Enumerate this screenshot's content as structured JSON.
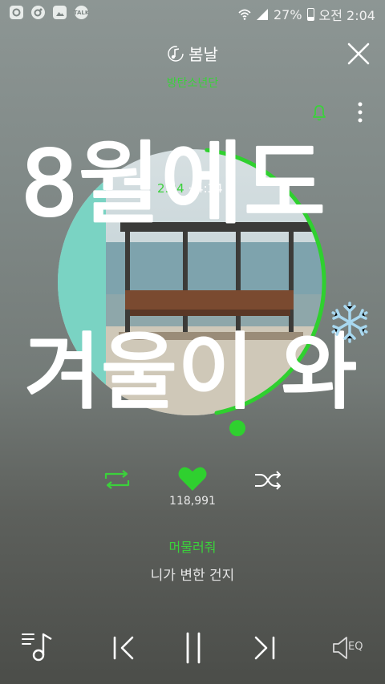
{
  "status_bar": {
    "left_icons": [
      "notification-app-icon",
      "kakaostory-icon",
      "gallery-icon",
      "kakaotalk-icon"
    ],
    "talk_label": "TALK",
    "battery": "27%",
    "time": "오전 2:04"
  },
  "header": {
    "song_title": "봄날",
    "artist": "방탄소년단"
  },
  "player": {
    "current_time": "2:04",
    "separator": "·",
    "total_time": "4:34",
    "progress": 0.45,
    "like_count": "118,991"
  },
  "lyrics": {
    "current": "머물러줘",
    "next": "니가 변한 건지"
  },
  "overlay": {
    "handwritten_line1": "8월에도",
    "handwritten_line2": "겨울이 와"
  },
  "controls": {
    "eq_label": "EQ"
  },
  "colors": {
    "accent": "#3bd13b",
    "album_sky": "#c5d4d8",
    "album_sea": "#7ea3ad",
    "album_sand": "#cfc8b8",
    "album_teal_strip": "#7ad3c3"
  }
}
